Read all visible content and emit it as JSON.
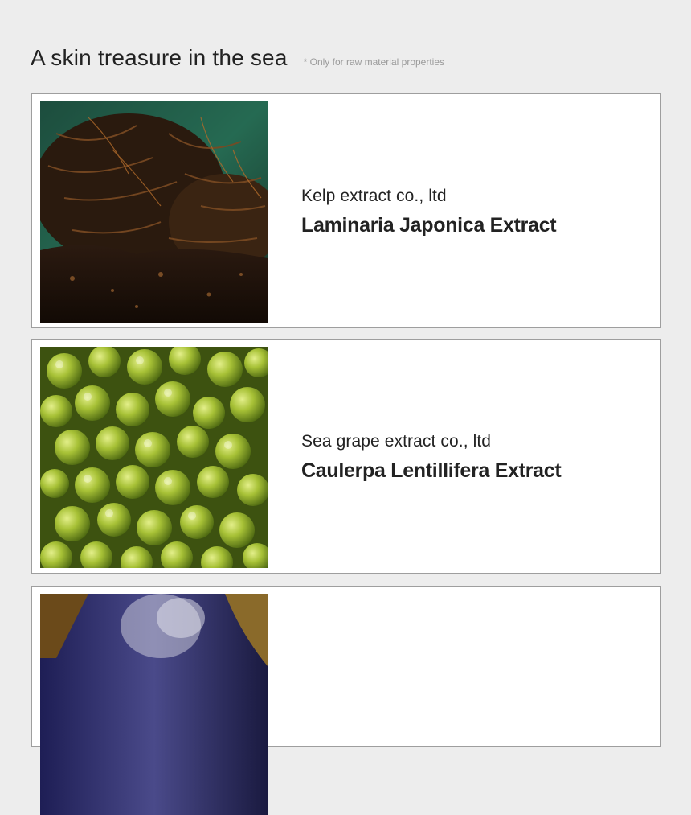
{
  "header": {
    "title": "A skin treasure in the sea",
    "note": "* Only for raw material properties"
  },
  "items": [
    {
      "company": "Kelp extract co., ltd",
      "extract": "Laminaria Japonica Extract",
      "image_icon": "kelp-photo"
    },
    {
      "company": "Sea grape extract co., ltd",
      "extract": "Caulerpa Lentillifera Extract",
      "image_icon": "sea-grape-photo"
    },
    {
      "company": "",
      "extract": "",
      "image_icon": "seaweed-photo"
    }
  ],
  "colors": {
    "background": "#ededed",
    "card": "#ffffff",
    "border": "#9e9e9e",
    "kelp_water": "#2a8a6e",
    "grape_green": "#9bb82f",
    "third_purple": "#3a3a7a"
  }
}
